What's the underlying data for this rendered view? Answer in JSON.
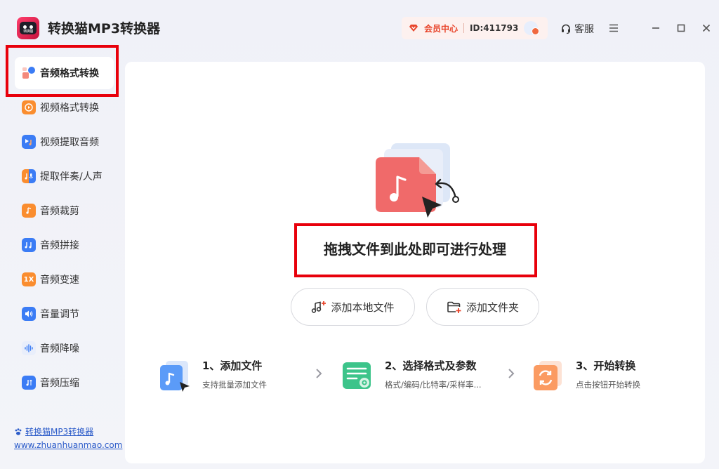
{
  "app": {
    "title": "转换猫MP3转换器",
    "logo_text": "转换猫"
  },
  "header": {
    "vip_label": "会员中心",
    "user_id": "ID:411793",
    "service_label": "客服"
  },
  "sidebar": {
    "items": [
      {
        "label": "音频格式转换",
        "icon": "audio-convert-icon",
        "active": true
      },
      {
        "label": "视频格式转换",
        "icon": "video-convert-icon"
      },
      {
        "label": "视频提取音频",
        "icon": "video-extract-audio-icon"
      },
      {
        "label": "提取伴奏/人声",
        "icon": "vocal-separate-icon"
      },
      {
        "label": "音频裁剪",
        "icon": "audio-cut-icon"
      },
      {
        "label": "音频拼接",
        "icon": "audio-merge-icon"
      },
      {
        "label": "音频变速",
        "icon": "audio-speed-icon",
        "badge": "1X"
      },
      {
        "label": "音量调节",
        "icon": "volume-icon"
      },
      {
        "label": "音频降噪",
        "icon": "denoise-icon"
      },
      {
        "label": "音频压缩",
        "icon": "audio-compress-icon"
      }
    ],
    "footer_link": "转换猫MP3转换器",
    "website": "www.zhuanhuanmao.com"
  },
  "main": {
    "drop_text": "拖拽文件到此处即可进行处理",
    "add_file_label": "添加本地文件",
    "add_folder_label": "添加文件夹",
    "steps": [
      {
        "title": "1、添加文件",
        "desc": "支持批量添加文件"
      },
      {
        "title": "2、选择格式及参数",
        "desc": "格式/编码/比特率/采样率..."
      },
      {
        "title": "3、开始转换",
        "desc": "点击按钮开始转换"
      }
    ]
  },
  "colors": {
    "accent_red": "#e8452b",
    "highlight_red": "#e8000b",
    "link_blue": "#2b5bc9"
  }
}
